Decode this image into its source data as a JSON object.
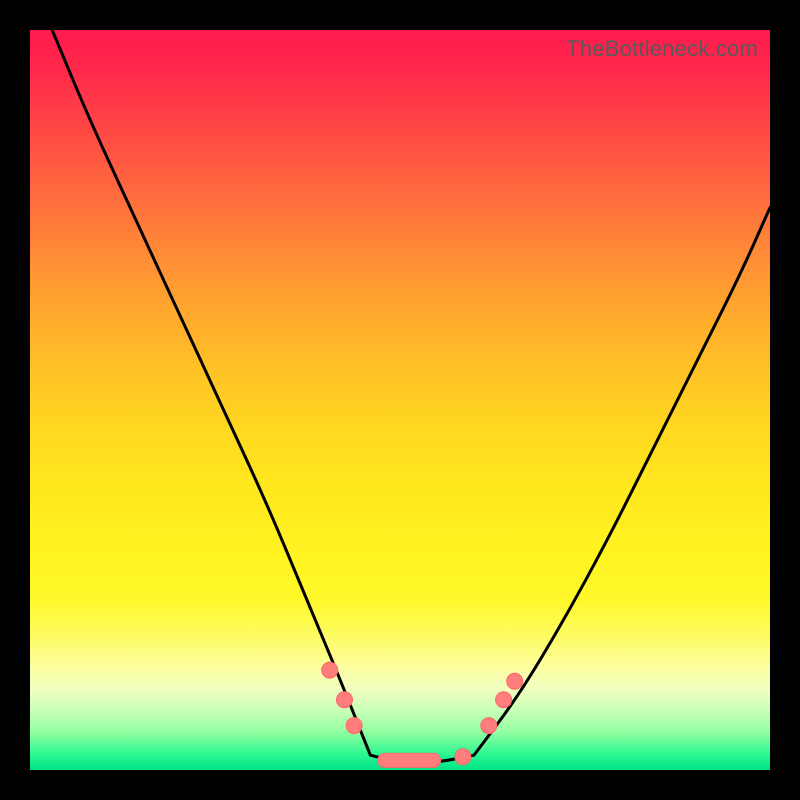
{
  "watermark": "TheBottleneck.com",
  "chart_data": {
    "type": "line",
    "title": "",
    "xlabel": "",
    "ylabel": "",
    "xlim": [
      0,
      1
    ],
    "ylim": [
      0,
      1
    ],
    "grid": false,
    "legend": false,
    "note": "Values are normalized 0–1 within plot area; no axes or ticks are rendered in source image.",
    "series": [
      {
        "name": "left-branch",
        "x": [
          0.03,
          0.08,
          0.14,
          0.2,
          0.26,
          0.32,
          0.37,
          0.42,
          0.46
        ],
        "y": [
          1.0,
          0.88,
          0.75,
          0.62,
          0.49,
          0.36,
          0.24,
          0.12,
          0.02
        ]
      },
      {
        "name": "flat-valley",
        "x": [
          0.46,
          0.5,
          0.55,
          0.6
        ],
        "y": [
          0.02,
          0.01,
          0.01,
          0.02
        ]
      },
      {
        "name": "right-branch",
        "x": [
          0.6,
          0.66,
          0.72,
          0.78,
          0.84,
          0.9,
          0.96,
          1.0
        ],
        "y": [
          0.02,
          0.1,
          0.2,
          0.31,
          0.43,
          0.55,
          0.67,
          0.76
        ]
      }
    ],
    "markers": [
      {
        "name": "left-cluster",
        "points": [
          [
            0.405,
            0.135
          ],
          [
            0.425,
            0.095
          ],
          [
            0.438,
            0.06
          ]
        ]
      },
      {
        "name": "valley-span",
        "shape": "hbar",
        "x0": 0.47,
        "x1": 0.555,
        "y": 0.013
      },
      {
        "name": "valley-right-dot",
        "points": [
          [
            0.585,
            0.018
          ]
        ]
      },
      {
        "name": "right-cluster",
        "points": [
          [
            0.62,
            0.06
          ],
          [
            0.64,
            0.095
          ],
          [
            0.655,
            0.12
          ]
        ]
      }
    ],
    "background_gradient": {
      "top": "#ff1a4e",
      "mid": "#ffe81e",
      "bottom": "#00e288"
    }
  }
}
